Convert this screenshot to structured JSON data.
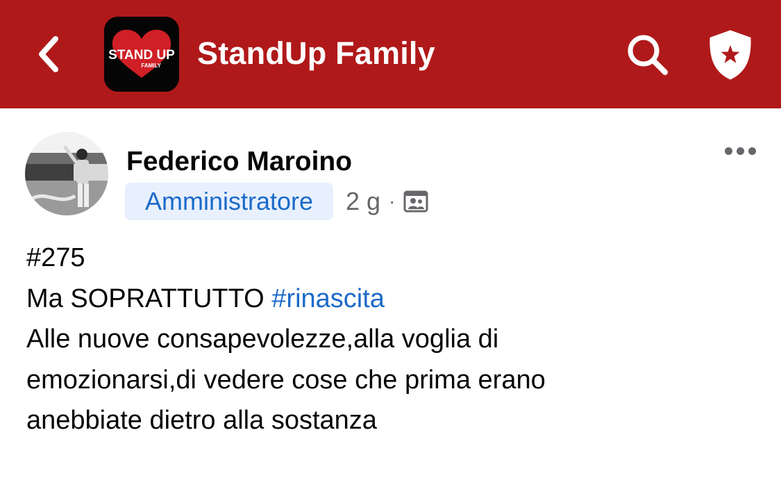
{
  "header": {
    "group_name": "StandUp Family",
    "logo_text_main": "STAND UP",
    "logo_text_sub": "FAMILY",
    "background_color": "#b0191a",
    "icons": {
      "back": "chevron-left-icon",
      "search": "search-icon",
      "admin": "shield-star-icon"
    }
  },
  "post": {
    "author": {
      "name": "Federico Maroino",
      "role": "Amministratore"
    },
    "time_ago": "2 g",
    "separator": "·",
    "audience_icon": "group-audience-icon",
    "more_icon": "more-dots-icon",
    "body": {
      "line1": "#275",
      "line2_prefix": "Ma SOPRATTUTTO ",
      "line2_hashtag": "#rinascita",
      "line3": "Alle nuove consapevolezze,alla voglia di",
      "line4": "emozionarsi,di vedere cose che prima erano",
      "line5": "anebbiate dietro alla sostanza"
    }
  },
  "colors": {
    "link": "#1b6ac9",
    "badge_bg": "#e7f0fc",
    "text": "#050505",
    "muted": "#65676b"
  }
}
